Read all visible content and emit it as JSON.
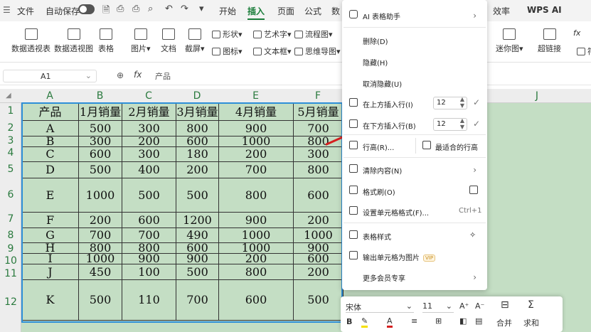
{
  "menubar": {
    "file": "文件",
    "autosave": "自动保存",
    "tabs": [
      "开始",
      "插入",
      "页面",
      "公式",
      "数"
    ],
    "right_tabs": [
      "效率",
      "WPS AI"
    ]
  },
  "ribbon": {
    "pivot_table": "数据透视表",
    "pivot_chart": "数据透视图",
    "table": "表格",
    "picture": "图片",
    "doc": "文档",
    "screenshot": "截屏",
    "shape": "形状",
    "art_text": "艺术字",
    "flowchart": "流程图",
    "icon": "图标",
    "textbox": "文本框",
    "mindmap": "思维导图",
    "sparkline": "迷你图",
    "hyperlink": "超链接",
    "fx_partial": "fx",
    "partial": "符"
  },
  "formula_bar": {
    "name_box": "A1",
    "fx": "fx",
    "content": "产品"
  },
  "columns": [
    "A",
    "B",
    "C",
    "D",
    "E",
    "F",
    "J"
  ],
  "rows": [
    "1",
    "2",
    "3",
    "4",
    "5",
    "6",
    "7",
    "8",
    "9",
    "10",
    "11",
    "12"
  ],
  "table": {
    "header": [
      "产品",
      "1月销量",
      "2月销量",
      "3月销量",
      "4月销量",
      "5月销量"
    ],
    "rows": [
      [
        "A",
        "500",
        "300",
        "800",
        "900",
        "700"
      ],
      [
        "B",
        "300",
        "200",
        "600",
        "1000",
        "800"
      ],
      [
        "C",
        "600",
        "300",
        "180",
        "200",
        "300"
      ],
      [
        "D",
        "500",
        "400",
        "200",
        "700",
        "800"
      ],
      [
        "E",
        "1000",
        "500",
        "500",
        "800",
        "600"
      ],
      [
        "F",
        "200",
        "600",
        "1200",
        "900",
        "200"
      ],
      [
        "G",
        "700",
        "700",
        "490",
        "1000",
        "1000"
      ],
      [
        "H",
        "800",
        "800",
        "600",
        "1000",
        "900"
      ],
      [
        "I",
        "1000",
        "900",
        "900",
        "200",
        "600"
      ],
      [
        "J",
        "450",
        "100",
        "500",
        "800",
        "200"
      ],
      [
        "K",
        "500",
        "110",
        "700",
        "600",
        "500"
      ]
    ]
  },
  "context_menu": {
    "ai": "AI 表格助手",
    "delete": "删除(D)",
    "hide": "隐藏(H)",
    "unhide": "取消隐藏(U)",
    "insert_above": "在上方插入行(I)",
    "insert_above_count": "12",
    "insert_below": "在下方插入行(B)",
    "insert_below_count": "12",
    "row_height": "行高(R)...",
    "best_fit": "最适合的行高",
    "clear": "清除内容(N)",
    "format_painter": "格式刷(O)",
    "format_cells": "设置单元格格式(F)...",
    "format_cells_shortcut": "Ctrl+1",
    "table_style": "表格样式",
    "export_image": "输出单元格为图片",
    "vip": "VIP",
    "more_member": "更多会员专享"
  },
  "mini_toolbar": {
    "font": "宋体",
    "size": "11",
    "bold": "B",
    "font_color": "A",
    "merge": "合并",
    "sum": "求和"
  },
  "colors": {
    "selection": "#2e8fd8",
    "sheet_fill": "#c4dec4",
    "accent": "#1a7d3a",
    "arrow": "#d62020"
  }
}
